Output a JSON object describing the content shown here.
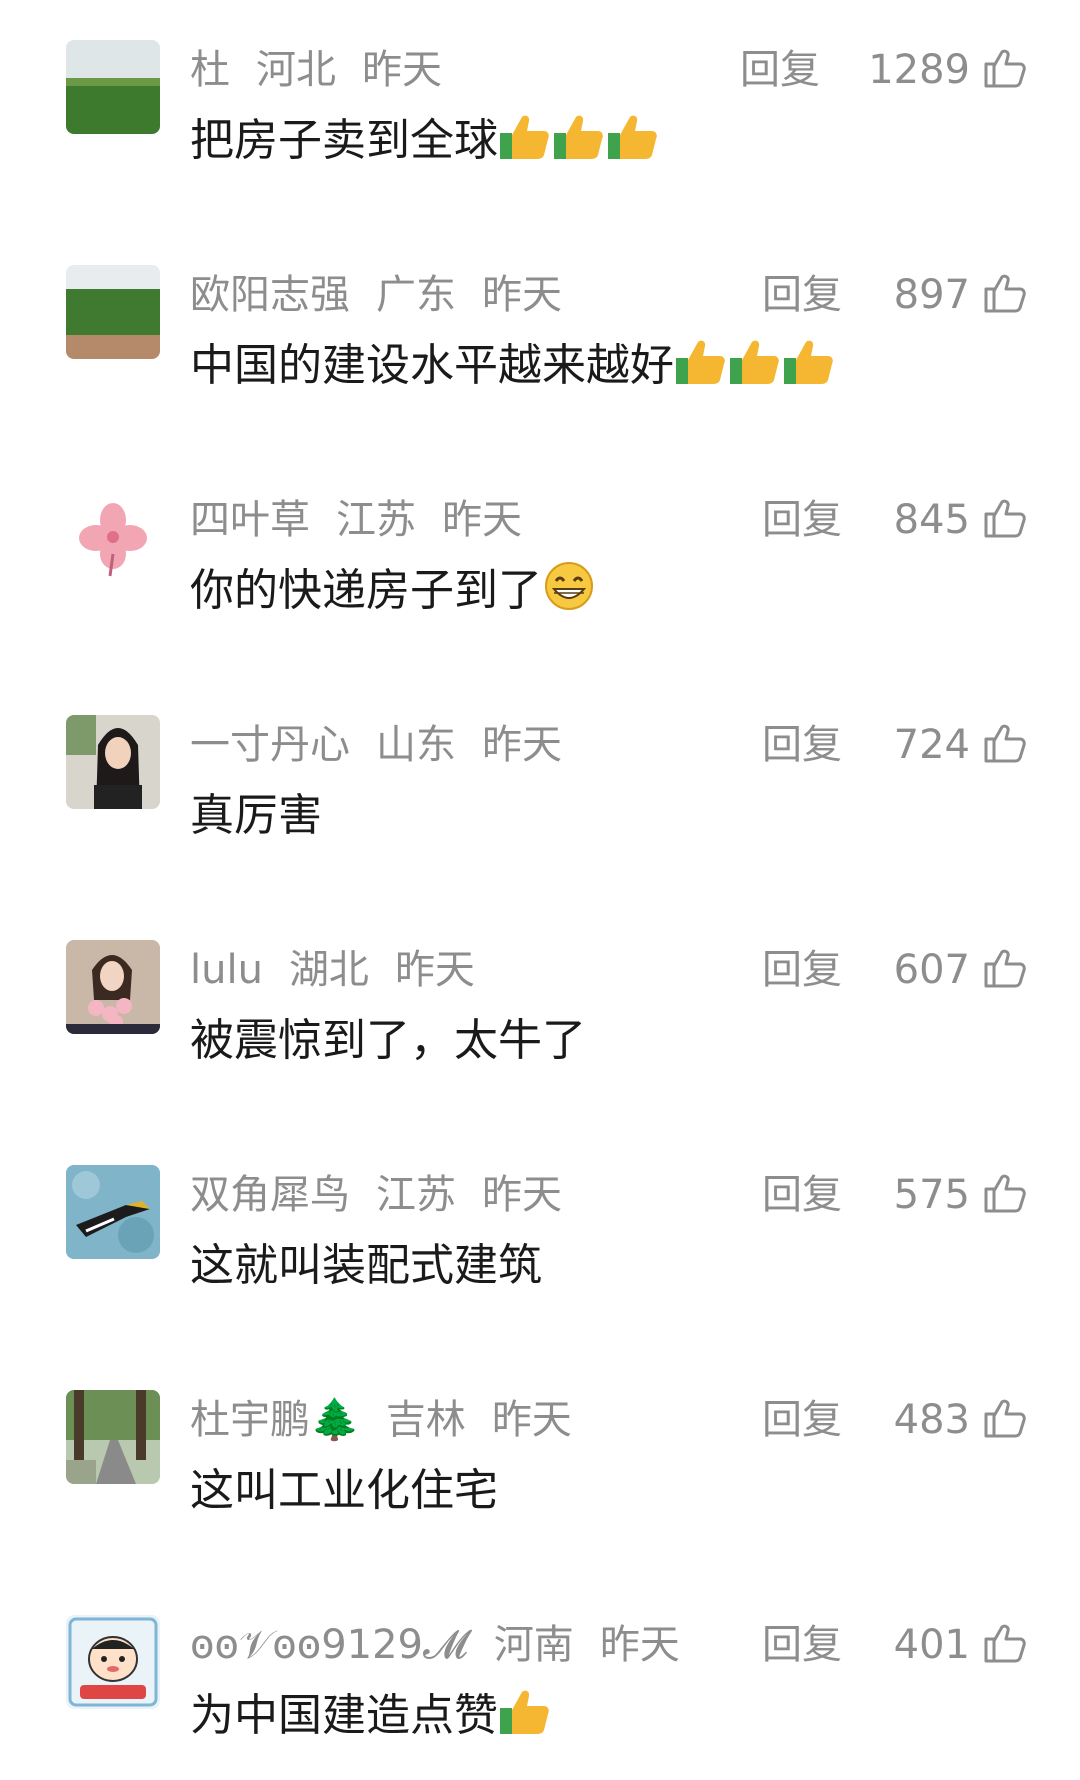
{
  "reply_label": "回复",
  "comments": [
    {
      "user": "杜",
      "location": "河北",
      "time": "昨天",
      "likes": "1289",
      "text": "把房子卖到全球",
      "emoji": [
        "thumbs-up",
        "thumbs-up",
        "thumbs-up"
      ]
    },
    {
      "user": "欧阳志强",
      "location": "广东",
      "time": "昨天",
      "likes": "897",
      "text": "中国的建设水平越来越好",
      "emoji": [
        "thumbs-up",
        "thumbs-up",
        "thumbs-up"
      ]
    },
    {
      "user": "四叶草",
      "location": "江苏",
      "time": "昨天",
      "likes": "845",
      "text": "你的快递房子到了",
      "emoji": [
        "grin"
      ]
    },
    {
      "user": "一寸丹心",
      "location": "山东",
      "time": "昨天",
      "likes": "724",
      "text": "真厉害",
      "emoji": []
    },
    {
      "user": "lulu",
      "location": "湖北",
      "time": "昨天",
      "likes": "607",
      "text": "被震惊到了，太牛了",
      "emoji": []
    },
    {
      "user": "双角犀鸟",
      "location": "江苏",
      "time": "昨天",
      "likes": "575",
      "text": "这就叫装配式建筑",
      "emoji": []
    },
    {
      "user": "杜宇鹏🌲",
      "location": "吉林",
      "time": "昨天",
      "likes": "483",
      "text": "这叫工业化住宅",
      "emoji": []
    },
    {
      "user": "ꙩꙩ𝒱ꙩꙩ9129𝓜",
      "location": "河南",
      "time": "昨天",
      "likes": "401",
      "text": "为中国建造点赞",
      "emoji": [
        "thumbs-up"
      ]
    }
  ]
}
